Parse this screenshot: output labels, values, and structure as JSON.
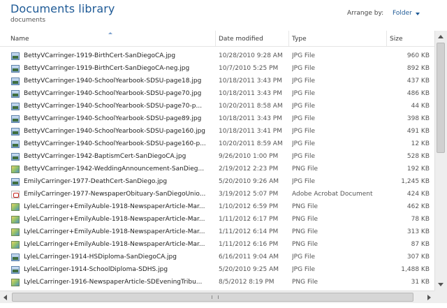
{
  "library": {
    "title": "Documents library",
    "subtitle": "documents",
    "arrange_label": "Arrange by:",
    "arrange_value": "Folder"
  },
  "columns": {
    "name": "Name",
    "date": "Date modified",
    "type": "Type",
    "size": "Size"
  },
  "files": [
    {
      "name": "BettyVCarringer-1919-BirthCert-SanDiegoCA.jpg",
      "date": "10/28/2010 9:28 AM",
      "type": "JPG File",
      "size": "960 KB",
      "icon": "jpg-file-icon"
    },
    {
      "name": "BettyVCarringer-1919-BirthCert-SanDiegoCA-neg.jpg",
      "date": "10/7/2010 5:25 PM",
      "type": "JPG File",
      "size": "892 KB",
      "icon": "jpg-file-icon"
    },
    {
      "name": "BettyVCarringer-1940-SchoolYearbook-SDSU-page18.jpg",
      "date": "10/18/2011 3:43 PM",
      "type": "JPG File",
      "size": "437 KB",
      "icon": "jpg-file-icon"
    },
    {
      "name": "BettyVCarringer-1940-SchoolYearbook-SDSU-page70.jpg",
      "date": "10/18/2011 3:43 PM",
      "type": "JPG File",
      "size": "486 KB",
      "icon": "jpg-file-icon"
    },
    {
      "name": "BettyVCarringer-1940-SchoolYearbook-SDSU-page70-p...",
      "date": "10/20/2011 8:58 AM",
      "type": "JPG File",
      "size": "44 KB",
      "icon": "jpg-file-icon"
    },
    {
      "name": "BettyVCarringer-1940-SchoolYearbook-SDSU-page89.jpg",
      "date": "10/18/2011 3:43 PM",
      "type": "JPG File",
      "size": "398 KB",
      "icon": "jpg-file-icon"
    },
    {
      "name": "BettyVCarringer-1940-SchoolYearbook-SDSU-page160.jpg",
      "date": "10/18/2011 3:41 PM",
      "type": "JPG File",
      "size": "491 KB",
      "icon": "jpg-file-icon"
    },
    {
      "name": "BettyVCarringer-1940-SchoolYearbook-SDSU-page160-p...",
      "date": "10/20/2011 8:59 AM",
      "type": "JPG File",
      "size": "12 KB",
      "icon": "jpg-file-icon"
    },
    {
      "name": "BettyVCarringer-1942-BaptismCert-SanDiegoCA.jpg",
      "date": "9/26/2010 1:00 PM",
      "type": "JPG File",
      "size": "528 KB",
      "icon": "jpg-file-icon"
    },
    {
      "name": "BettyVCarringer-1942-WeddingAnnouncement-SanDieg...",
      "date": "2/19/2012 2:23 PM",
      "type": "PNG File",
      "size": "192 KB",
      "icon": "png-file-icon"
    },
    {
      "name": "EmilyCarringer-1977-DeathCert-SanDiego.jpg",
      "date": "5/20/2010 9:26 AM",
      "type": "JPG File",
      "size": "1,245 KB",
      "icon": "jpg-file-icon"
    },
    {
      "name": "EmilyCarringer-1977-NewspaperObituary-SanDiegoUnio...",
      "date": "3/19/2012 5:07 PM",
      "type": "Adobe Acrobat Document",
      "size": "424 KB",
      "icon": "pdf-file-icon"
    },
    {
      "name": "LyleLCarringer+EmilyAuble-1918-NewspaperArticle-Mar...",
      "date": "1/10/2012 6:59 PM",
      "type": "PNG File",
      "size": "462 KB",
      "icon": "png-file-icon"
    },
    {
      "name": "LyleLCarringer+EmilyAuble-1918-NewspaperArticle-Mar...",
      "date": "1/11/2012 6:17 PM",
      "type": "PNG File",
      "size": "78 KB",
      "icon": "png-file-icon"
    },
    {
      "name": "LyleLCarringer+EmilyAuble-1918-NewspaperArticle-Mar...",
      "date": "1/11/2012 6:14 PM",
      "type": "PNG File",
      "size": "313 KB",
      "icon": "png-file-icon"
    },
    {
      "name": "LyleLCarringer+EmilyAuble-1918-NewspaperArticle-Mar...",
      "date": "1/11/2012 6:16 PM",
      "type": "PNG File",
      "size": "87 KB",
      "icon": "png-file-icon"
    },
    {
      "name": "LyleLCarringer-1914-HSDiploma-SanDiegoCA.jpg",
      "date": "6/16/2011 9:04 AM",
      "type": "JPG File",
      "size": "307 KB",
      "icon": "jpg-file-icon"
    },
    {
      "name": "LyleLCarringer-1914-SchoolDiploma-SDHS.jpg",
      "date": "5/20/2010 9:25 AM",
      "type": "JPG File",
      "size": "1,488 KB",
      "icon": "jpg-file-icon"
    },
    {
      "name": "LyleLCarringer-1916-NewspaperArticle-SDEveningTribu...",
      "date": "8/5/2012 8:19 PM",
      "type": "PNG File",
      "size": "31 KB",
      "icon": "png-file-icon"
    }
  ]
}
